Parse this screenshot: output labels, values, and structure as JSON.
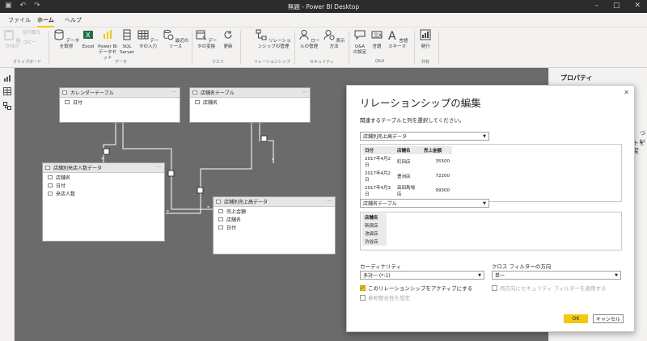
{
  "window": {
    "title": "無題 - Power BI Desktop"
  },
  "tabs": [
    {
      "label": "ファイル"
    },
    {
      "label": "ホーム"
    },
    {
      "label": "ヘルプ"
    }
  ],
  "ribbon": {
    "clipboard": {
      "paste": "貼り付け",
      "cut": "切り取り",
      "copy": "コピー",
      "group": "クリップボード"
    },
    "data": {
      "get_data": "データを取得",
      "excel": "Excel",
      "pbi_dataset_1": "Power BI",
      "pbi_dataset_2": "データセット",
      "sql_1": "SQL",
      "sql_2": "Server",
      "enter_data": "データの入力",
      "recent": "最近のソース",
      "group": "データ"
    },
    "query": {
      "transform": "データの変換",
      "refresh": "更新",
      "group": "クエリ"
    },
    "relationships": {
      "manage": "リレーションシップの管理",
      "group": "リレーションシップ"
    },
    "security": {
      "manage_roles": "ロールの管理",
      "view_as": "表示方法",
      "group": "セキュリティ"
    },
    "qa": {
      "setup_1": "Q&A",
      "setup_2": "の設定",
      "language": "言語",
      "schema": "言語スキーマ",
      "group": "Q&A"
    },
    "share": {
      "publish": "発行",
      "group": "共有"
    }
  },
  "canvas": {
    "tables": {
      "calendar": {
        "name": "カレンダーテーブル",
        "fields": [
          "日付"
        ]
      },
      "store_name": {
        "name": "店舗名テーブル",
        "fields": [
          "店舗名"
        ]
      },
      "visitors": {
        "name": "店舗別来店人数データ",
        "fields": [
          "店舗名",
          "日付",
          "来店人数"
        ]
      },
      "sales": {
        "name": "店舗別売上高データ",
        "fields": [
          "売上金額",
          "店舗名",
          "日付"
        ]
      }
    },
    "cardinality_labels": {
      "one": "1",
      "many": "*"
    }
  },
  "side_panel": {
    "title": "プロパティ",
    "snippet_1": "つい",
    "snippet_2": "トを変"
  },
  "dialog": {
    "title": "リレーションシップの編集",
    "subtitle": "関連するテーブルと列を選択してください。",
    "table1": {
      "selected": "店舗別売上高データ",
      "columns": [
        "日付",
        "店舗名",
        "売上金額"
      ],
      "rows": [
        [
          "2017年4月2日",
          "町田店",
          "35500"
        ],
        [
          "2017年4月2日",
          "豊洲店",
          "72200"
        ],
        [
          "2017年4月3日",
          "高田馬場店",
          "99300"
        ]
      ]
    },
    "table2": {
      "selected": "店舗名テーブル",
      "column": "店舗名",
      "rows": [
        "新宿店",
        "池袋店",
        "渋谷店"
      ]
    },
    "cardinality": {
      "label": "カーディナリティ",
      "value": "多対一 (*:1)"
    },
    "cross_filter": {
      "label": "クロス フィルターの方向",
      "value": "単一"
    },
    "active_label": "このリレーションシップをアクティブにする",
    "both_dir_label": "両方向にセキュリティ フィルターを適用する",
    "ref_integrity_label": "参照整合性を想定",
    "ok": "OK",
    "cancel": "キャンセル"
  }
}
